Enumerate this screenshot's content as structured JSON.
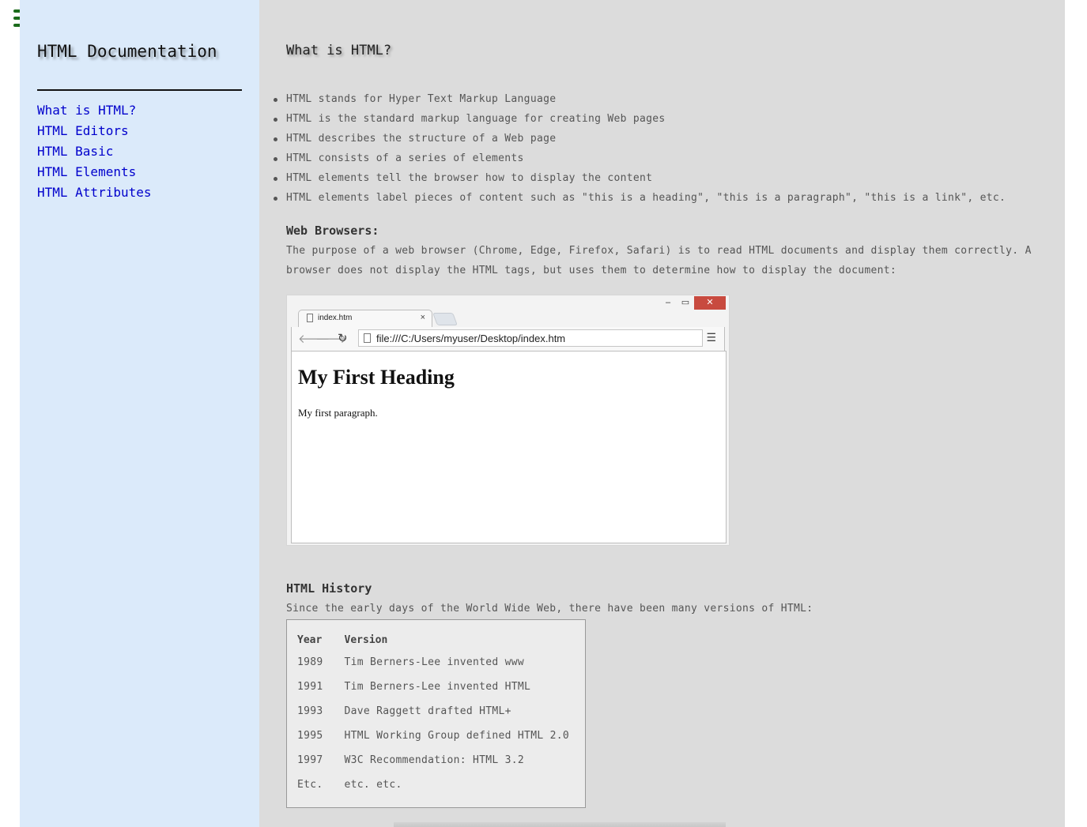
{
  "menu": {
    "icon": "hamburger-menu-icon"
  },
  "sidebar": {
    "title": "HTML Documentation",
    "items": [
      {
        "label": "What is HTML?"
      },
      {
        "label": "HTML Editors"
      },
      {
        "label": "HTML Basic"
      },
      {
        "label": "HTML Elements"
      },
      {
        "label": "HTML Attributes"
      }
    ],
    "link_color": "#0000cc",
    "background": "#dbeafa"
  },
  "main": {
    "background": "#dcdcdc",
    "title": "What is HTML?",
    "bullets": [
      "HTML stands for Hyper Text Markup Language",
      "HTML is the standard markup language for creating Web pages",
      "HTML describes the structure of a Web page",
      "HTML consists of a series of elements",
      "HTML elements tell the browser how to display the content",
      "HTML elements label pieces of content such as \"this is a heading\", \"this is a paragraph\", \"this is a link\", etc."
    ],
    "browsers_heading": "Web Browsers:",
    "browsers_text_line1": "The purpose of a web browser (Chrome, Edge, Firefox, Safari) is to read HTML documents and display them correctly. A",
    "browsers_text_line2": "browser does not display the HTML tags, but uses them to determine how to display the document:",
    "history_heading": "HTML History",
    "history_text": "Since the early days of the World Wide Web, there have been many versions of HTML:"
  },
  "browser_image": {
    "minimize": "‒",
    "maximize": "▭",
    "close": "✕",
    "tab_label": "index.htm",
    "tab_close": "×",
    "address": "file:///C:/Users/myuser/Desktop/index.htm",
    "heading": "My First Heading",
    "paragraph": "My first paragraph.",
    "close_color": "#c84a3f"
  },
  "history_table": {
    "headers": [
      "Year",
      "Version"
    ],
    "rows": [
      [
        "1989",
        "Tim Berners-Lee invented www"
      ],
      [
        "1991",
        "Tim Berners-Lee invented HTML"
      ],
      [
        "1993",
        "Dave Raggett drafted HTML+"
      ],
      [
        "1995",
        "HTML Working Group defined HTML 2.0"
      ],
      [
        "1997",
        "W3C Recommendation: HTML 3.2"
      ],
      [
        "Etc.",
        "etc. etc."
      ]
    ]
  }
}
